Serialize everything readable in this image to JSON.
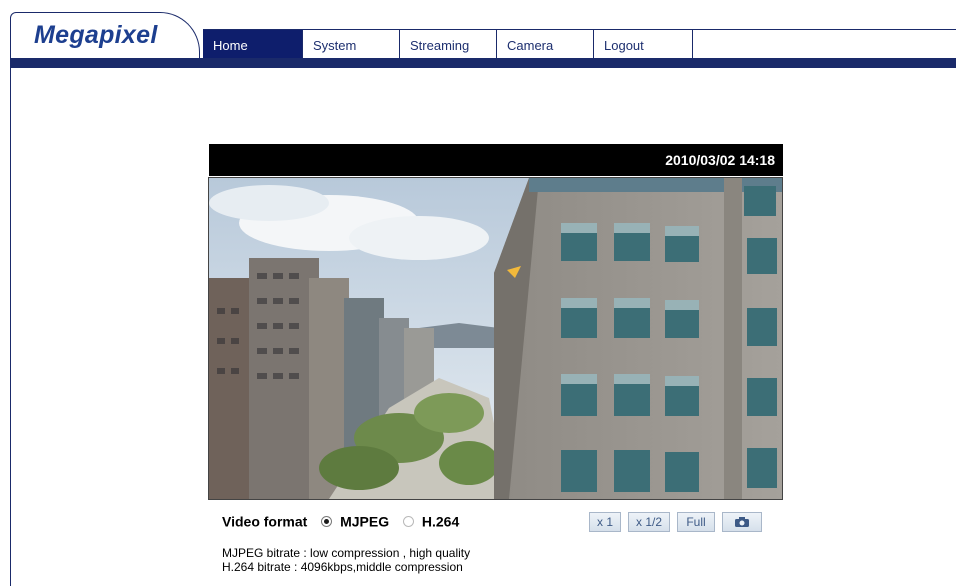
{
  "brand": {
    "name": "Megapixel"
  },
  "nav": {
    "items": [
      {
        "label": "Home",
        "active": true
      },
      {
        "label": "System",
        "active": false
      },
      {
        "label": "Streaming",
        "active": false
      },
      {
        "label": "Camera",
        "active": false
      },
      {
        "label": "Logout",
        "active": false
      }
    ]
  },
  "video": {
    "timestamp": "2010/03/02 14:18",
    "format_label": "Video format",
    "options": [
      {
        "label": "MJPEG",
        "selected": true
      },
      {
        "label": "H.264",
        "selected": false
      }
    ],
    "info": [
      "MJPEG bitrate : low compression , high quality",
      "H.264 bitrate : 4096kbps,middle compression"
    ]
  },
  "view_controls": {
    "x1": "x 1",
    "half": "x 1/2",
    "full": "Full",
    "snapshot_icon": "camera-icon"
  },
  "colors": {
    "nav_active": "#0e1e6c",
    "brand_blue": "#1d3f8f",
    "frame_border": "#1a2a6a"
  }
}
